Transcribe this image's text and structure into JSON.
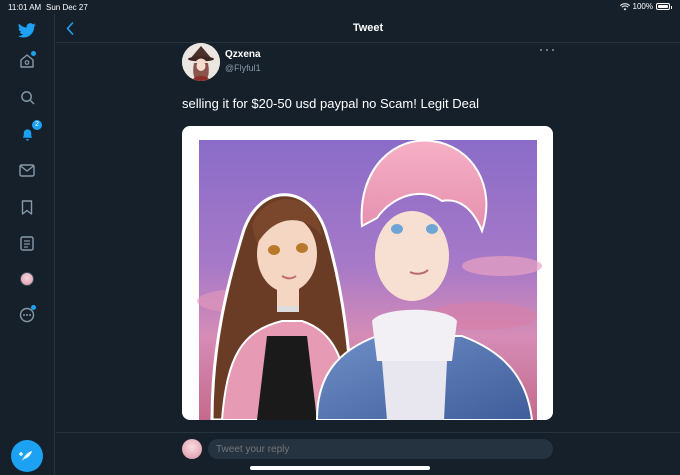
{
  "status_bar": {
    "time": "11:01 AM",
    "date": "Sun Dec 27",
    "battery": "100%"
  },
  "sidebar": {
    "items": [
      {
        "icon": "twitter-logo-icon"
      },
      {
        "icon": "home-icon"
      },
      {
        "icon": "search-icon"
      },
      {
        "icon": "bell-icon",
        "badge": "2"
      },
      {
        "icon": "mail-icon"
      },
      {
        "icon": "bookmark-icon"
      },
      {
        "icon": "list-icon"
      },
      {
        "icon": "profile-avatar-icon"
      },
      {
        "icon": "more-circle-icon"
      }
    ],
    "compose_icon": "compose-feather-icon"
  },
  "header": {
    "title": "Tweet"
  },
  "tweet": {
    "author_name": "Qzxena",
    "author_handle": "@Flyful1",
    "text": "selling it for $20-50 usd paypal no Scam! Legit Deal"
  },
  "reply": {
    "placeholder": "Tweet your reply"
  },
  "colors": {
    "background": "#15202b",
    "accent": "#1da1f2",
    "border": "#253341",
    "secondary_text": "#8899a6"
  }
}
